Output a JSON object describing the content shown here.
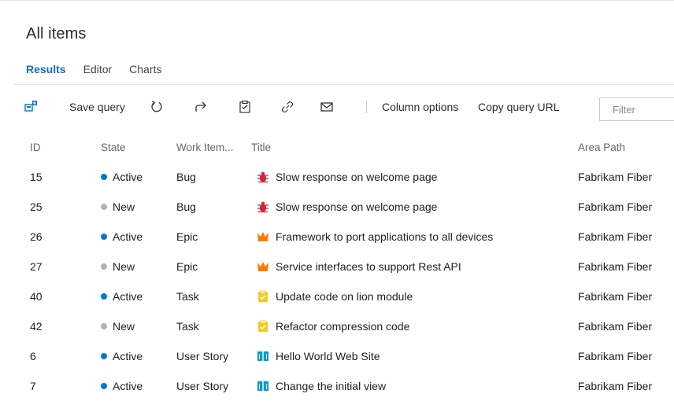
{
  "page": {
    "title": "All items"
  },
  "tabs": [
    {
      "label": "Results",
      "active": true
    },
    {
      "label": "Editor",
      "active": false
    },
    {
      "label": "Charts",
      "active": false
    }
  ],
  "toolbar": {
    "save_label": "Save query",
    "column_options_label": "Column options",
    "copy_url_label": "Copy query URL",
    "filter_placeholder": "Filter",
    "icons": [
      "new-item-icon",
      "refresh-icon",
      "redo-icon",
      "clipboard-icon",
      "link-icon",
      "mail-icon"
    ]
  },
  "grid": {
    "columns": [
      "ID",
      "State",
      "Work Item...",
      "Title",
      "Area Path"
    ],
    "rows": [
      {
        "id": "15",
        "state": "Active",
        "type": "Bug",
        "title": "Slow response on welcome page",
        "area": "Fabrikam Fiber"
      },
      {
        "id": "25",
        "state": "New",
        "type": "Bug",
        "title": "Slow response on welcome page",
        "area": "Fabrikam Fiber"
      },
      {
        "id": "26",
        "state": "Active",
        "type": "Epic",
        "title": "Framework to port applications to all devices",
        "area": "Fabrikam Fiber"
      },
      {
        "id": "27",
        "state": "New",
        "type": "Epic",
        "title": "Service interfaces to support Rest API",
        "area": "Fabrikam Fiber"
      },
      {
        "id": "40",
        "state": "Active",
        "type": "Task",
        "title": "Update code on lion module",
        "area": "Fabrikam Fiber"
      },
      {
        "id": "42",
        "state": "New",
        "type": "Task",
        "title": "Refactor compression code",
        "area": "Fabrikam Fiber"
      },
      {
        "id": "6",
        "state": "Active",
        "type": "User Story",
        "title": "Hello World Web Site",
        "area": "Fabrikam Fiber"
      },
      {
        "id": "7",
        "state": "Active",
        "type": "User Story",
        "title": "Change the initial view",
        "area": "Fabrikam Fiber"
      }
    ]
  },
  "colors": {
    "accent": "#106ebe",
    "state_active": "#007acc",
    "state_new": "#b2b2b2",
    "bug": "#cc293d",
    "epic": "#ff7b00",
    "task": "#f2cb1d",
    "user_story": "#009ccc"
  }
}
